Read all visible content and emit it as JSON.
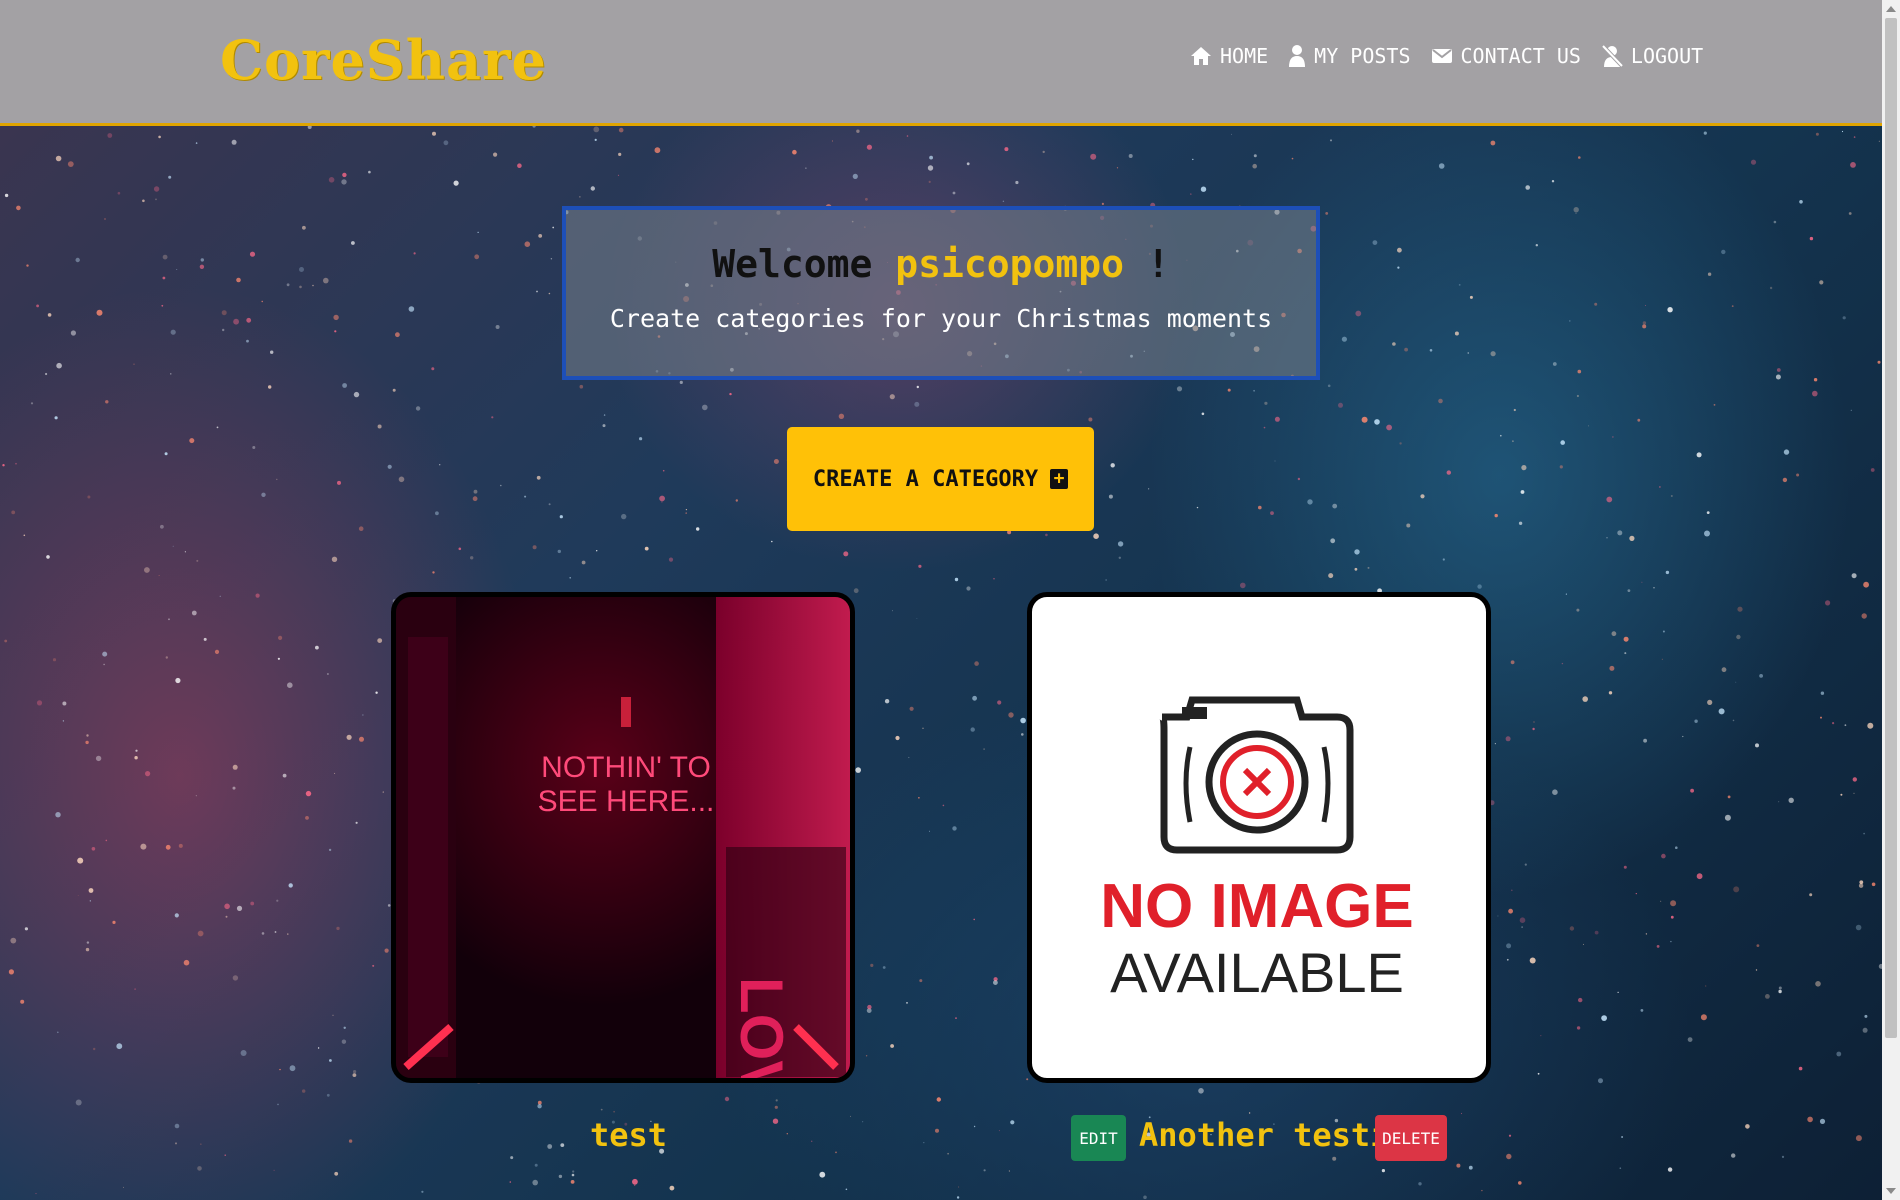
{
  "navbar": {
    "logo": "CoreShare",
    "items": [
      {
        "label": "HOME",
        "icon": "home-icon"
      },
      {
        "label": "MY POSTS",
        "icon": "user-icon"
      },
      {
        "label": "CONTACT US",
        "icon": "envelope-icon"
      },
      {
        "label": "LOGOUT",
        "icon": "user-slash-icon"
      }
    ]
  },
  "welcome": {
    "greeting": "Welcome",
    "username": "psicopompo",
    "exclaim": "!",
    "subtitle": "Create categories for your Christmas moments"
  },
  "create_button": {
    "label": "CREATE A CATEGORY",
    "icon": "plus-square-icon"
  },
  "categories": [
    {
      "title": "test",
      "image_text_1": "NOTHIN' TO",
      "image_text_2": "SEE HERE...",
      "wall_text": "LOVE"
    },
    {
      "title": "Another testing",
      "image_text_1": "NO IMAGE",
      "image_text_2": "AVAILABLE",
      "edit_label": "EDIT",
      "delete_label": "DELETE"
    }
  ],
  "colors": {
    "accent": "#f2c20f",
    "navbar": "#a3a1a4",
    "button": "#ffc107",
    "edit": "#198754",
    "delete": "#dc3545",
    "welcome_border": "#1d4fb8"
  }
}
